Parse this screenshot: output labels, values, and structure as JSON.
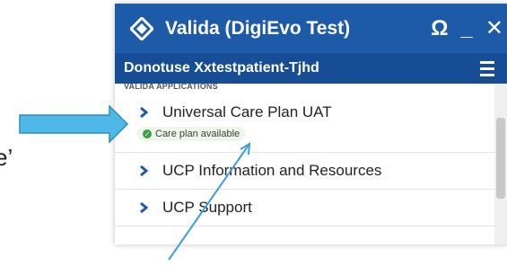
{
  "stray_text": "e’",
  "window": {
    "title": "Valida (DigiEvo Test)",
    "refresh_icon": "Ω",
    "minimize_label": "_",
    "close_label": "✕"
  },
  "patient_bar": {
    "name": "Donotuse Xxtestpatient-Tjhd"
  },
  "section": {
    "heading": "VALIDA APPLICATIONS"
  },
  "items": [
    {
      "label": "Universal Care Plan UAT",
      "badge": "Care plan available"
    },
    {
      "label": "UCP Information and Resources"
    },
    {
      "label": "UCP Support"
    }
  ],
  "colors": {
    "title_bar": "#1d5aa8",
    "patient_bar": "#174d94",
    "chevron": "#1d5aa8",
    "badge_dot": "#3aa043",
    "callout_arrow": "#4fb8e8"
  }
}
